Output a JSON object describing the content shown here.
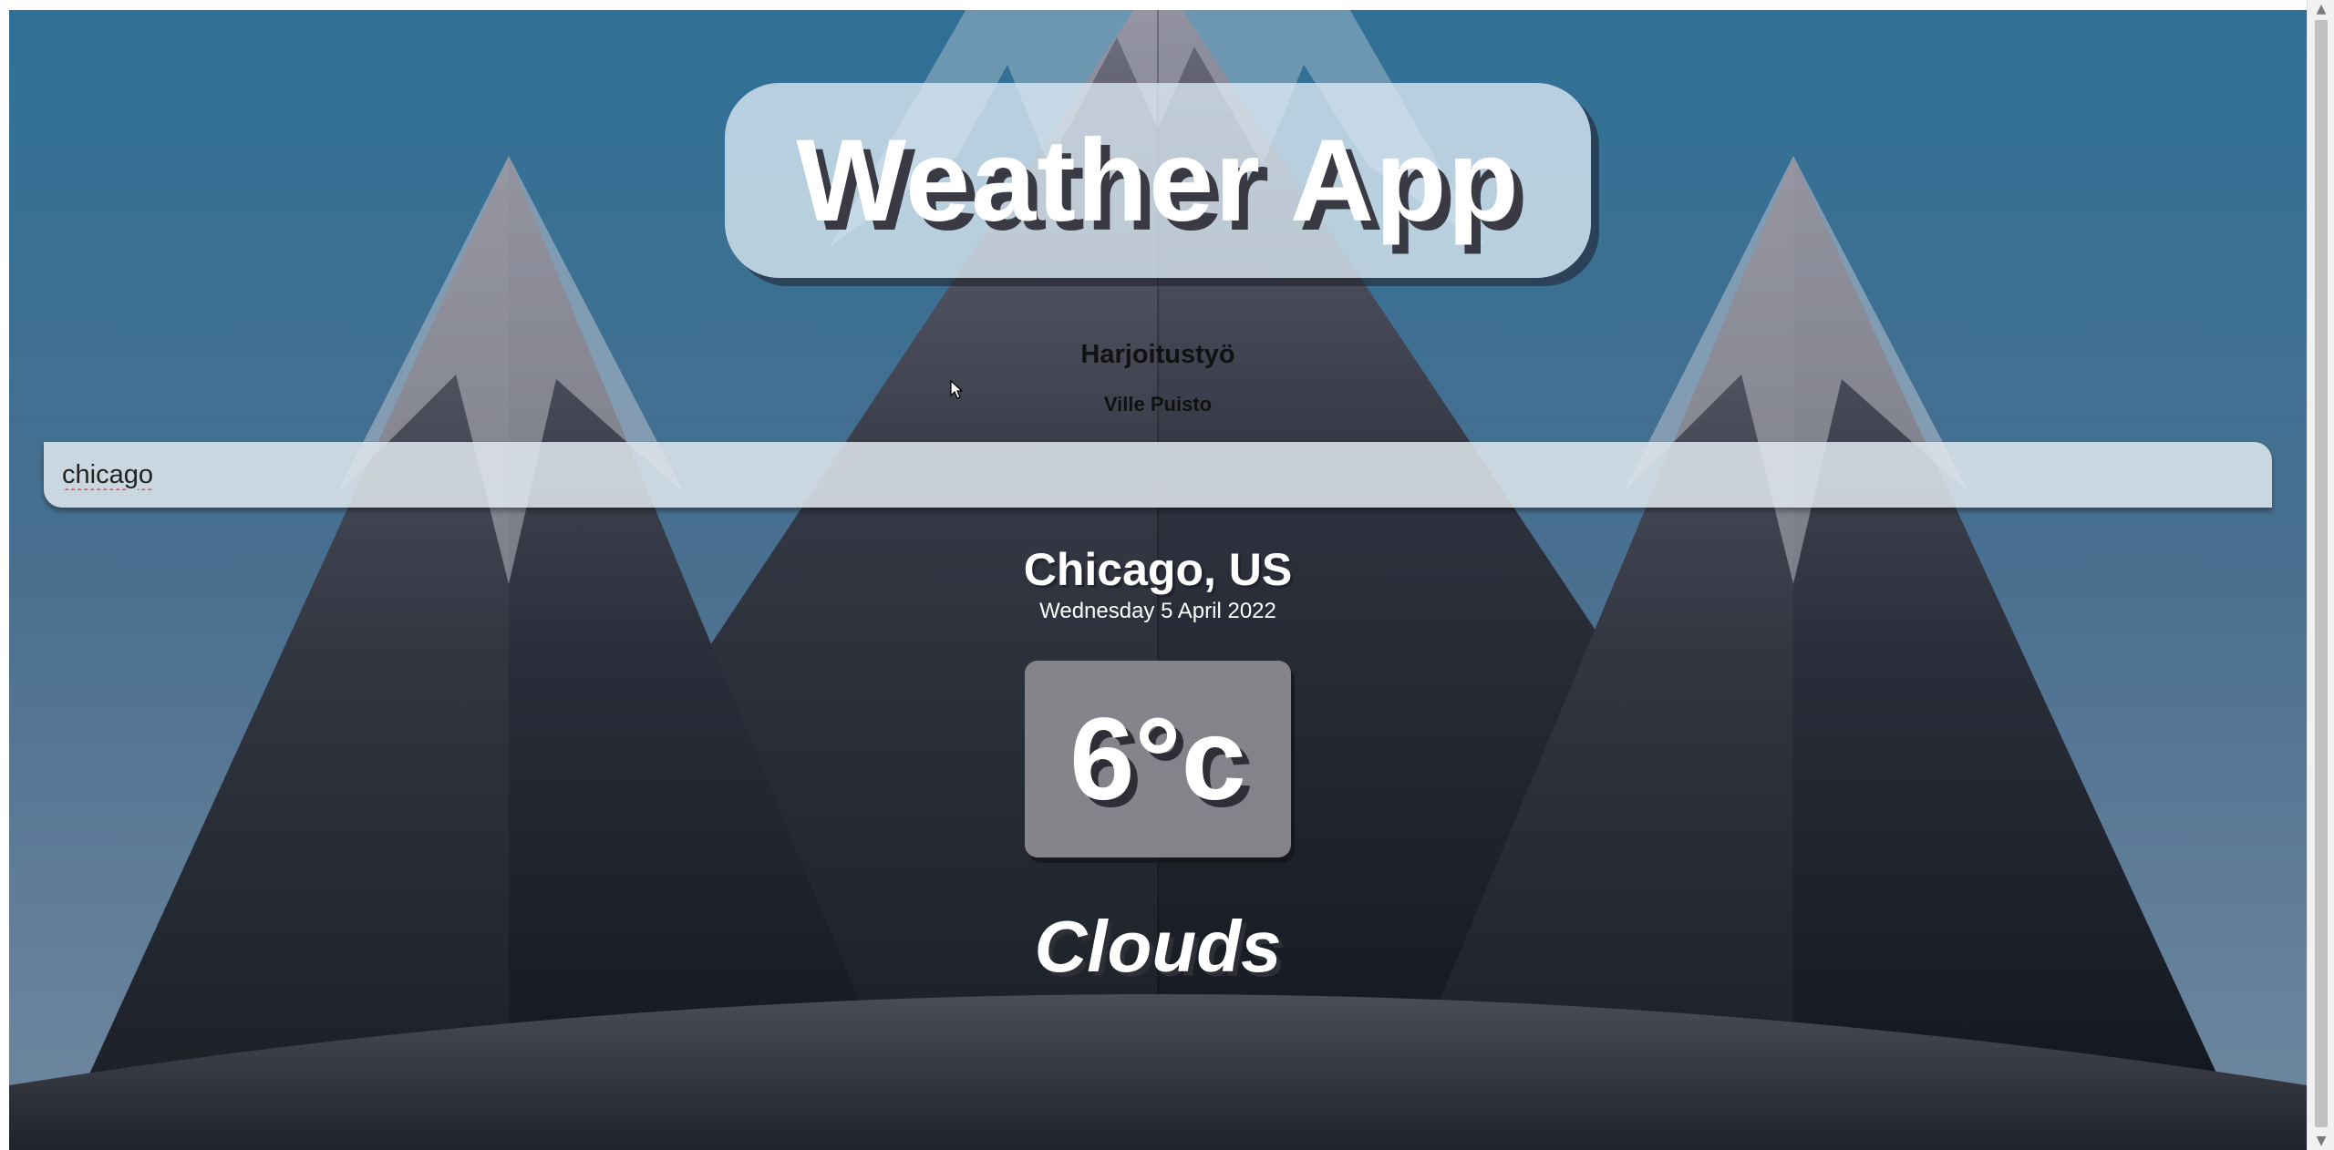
{
  "app": {
    "title": "Weather App",
    "subtitle": "Harjoitustyö",
    "author": "Ville Puisto"
  },
  "search": {
    "value": "chicago"
  },
  "weather": {
    "location": "Chicago, US",
    "date": "Wednesday 5 April 2022",
    "temperature": "6°c",
    "condition": "Clouds"
  },
  "icons": {
    "cursor": "mouse-pointer-icon",
    "scroll_up": "triangle-up-icon",
    "scroll_down": "triangle-down-icon"
  },
  "colors": {
    "sky_top": "#2f7097",
    "sky_bottom": "#6a84a0",
    "mountain_dark": "#121720",
    "ground": "#2a2d38"
  }
}
